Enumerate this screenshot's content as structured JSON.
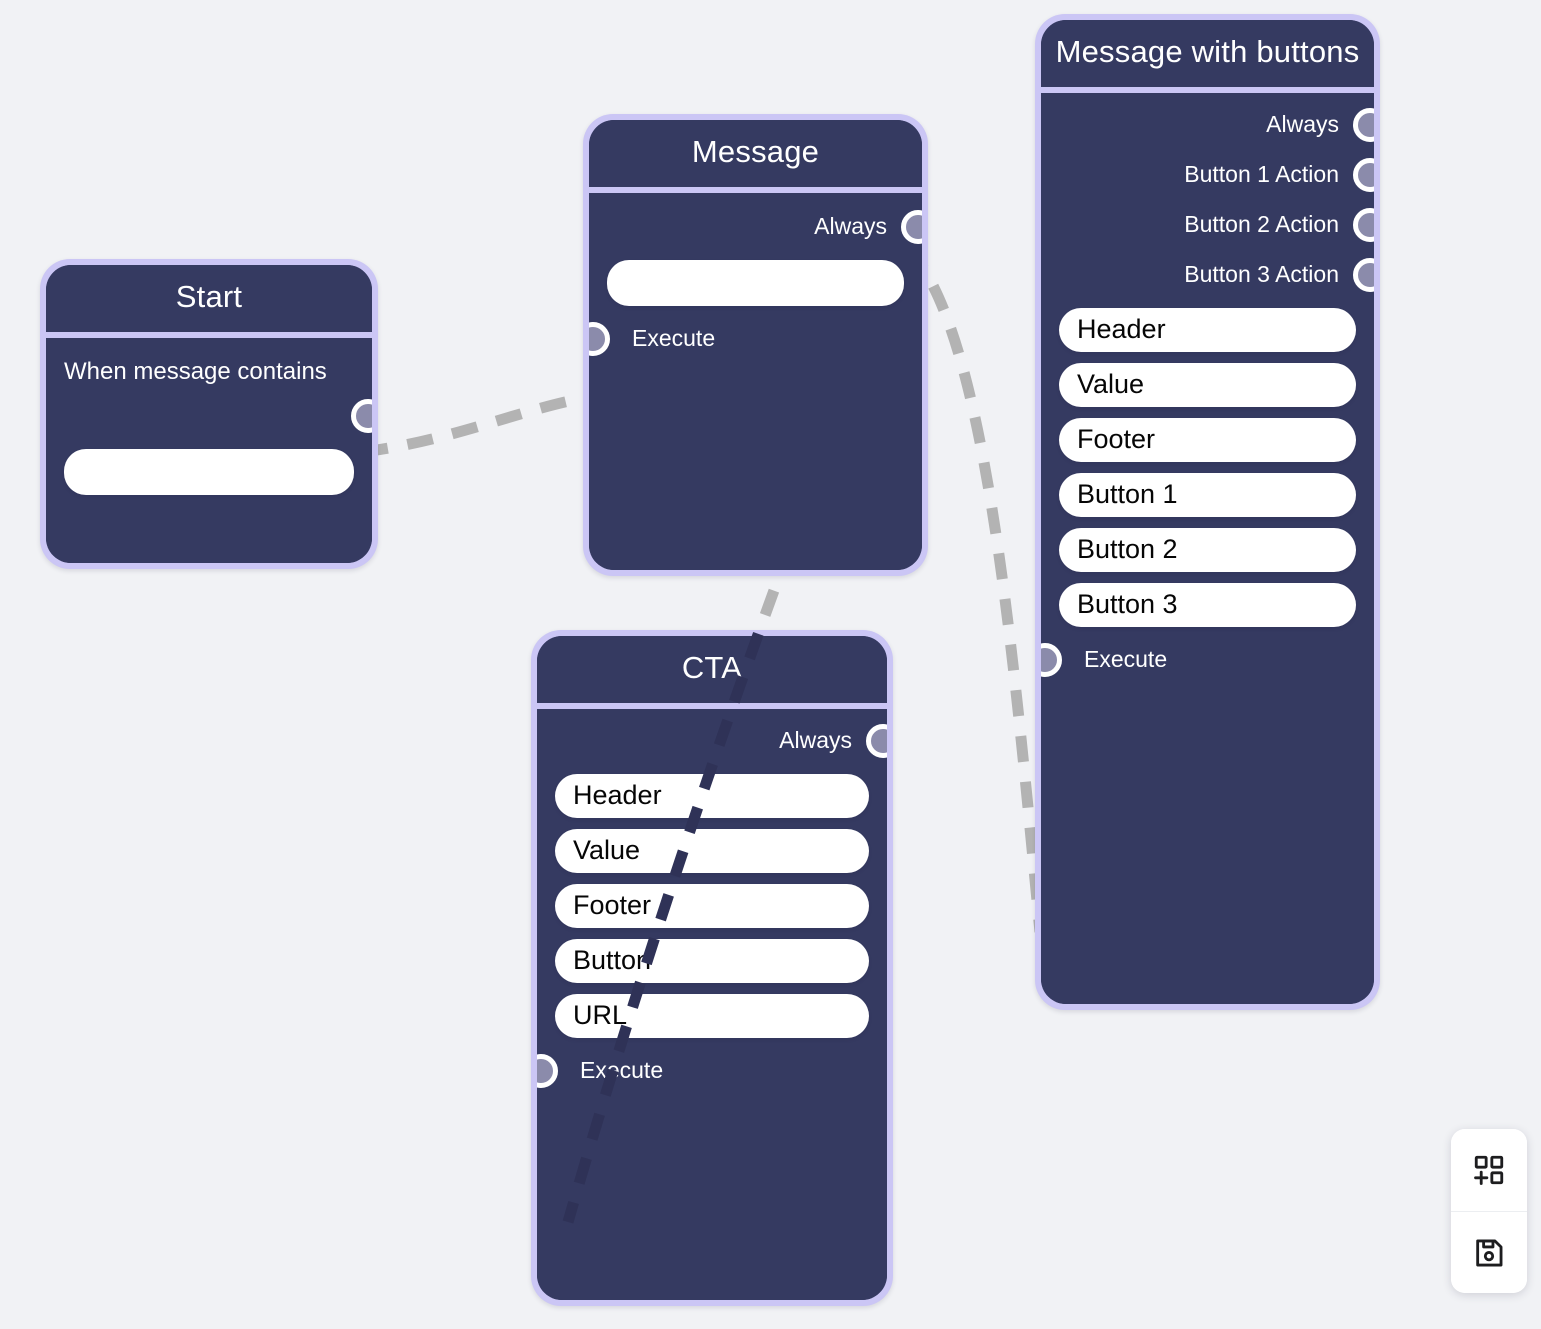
{
  "canvas": {
    "background_color": "#f1f2f5",
    "node_border_color": "#cbc6f5",
    "node_body_color": "#353a61",
    "port_color": "#8b8bab",
    "edge_color": "#b3b3b3"
  },
  "nodes": {
    "start": {
      "title": "Start",
      "condition_label": "When message contains",
      "output_port_label": "",
      "fields": [
        {
          "name": "keyword",
          "value": "",
          "placeholder": ""
        }
      ]
    },
    "message": {
      "title": "Message",
      "outputs": [
        {
          "label": "Always"
        }
      ],
      "inputs": [
        {
          "label": "Execute"
        }
      ],
      "fields": [
        {
          "name": "text",
          "value": "",
          "placeholder": ""
        }
      ]
    },
    "cta": {
      "title": "CTA",
      "outputs": [
        {
          "label": "Always"
        }
      ],
      "inputs": [
        {
          "label": "Execute"
        }
      ],
      "fields": [
        {
          "name": "header",
          "value": "Header",
          "placeholder": "Header"
        },
        {
          "name": "value",
          "value": "Value",
          "placeholder": "Value"
        },
        {
          "name": "footer",
          "value": "Footer",
          "placeholder": "Footer"
        },
        {
          "name": "button",
          "value": "Button",
          "placeholder": "Button"
        },
        {
          "name": "url",
          "value": "URL",
          "placeholder": "URL"
        }
      ]
    },
    "message_with_buttons": {
      "title": "Message with buttons",
      "outputs": [
        {
          "label": "Always"
        },
        {
          "label": "Button 1 Action"
        },
        {
          "label": "Button 2 Action"
        },
        {
          "label": "Button 3 Action"
        }
      ],
      "inputs": [
        {
          "label": "Execute"
        }
      ],
      "fields": [
        {
          "name": "header",
          "value": "Header",
          "placeholder": "Header"
        },
        {
          "name": "value",
          "value": "Value",
          "placeholder": "Value"
        },
        {
          "name": "footer",
          "value": "Footer",
          "placeholder": "Footer"
        },
        {
          "name": "button1",
          "value": "Button 1",
          "placeholder": "Button 1"
        },
        {
          "name": "button2",
          "value": "Button 2",
          "placeholder": "Button 2"
        },
        {
          "name": "button3",
          "value": "Button 3",
          "placeholder": "Button 3"
        }
      ]
    }
  },
  "edges": [
    {
      "from": "start.output",
      "to": "message.execute"
    },
    {
      "from": "message.always",
      "to": "cta.execute"
    },
    {
      "from": "message.always",
      "to": "message_with_buttons.execute"
    }
  ],
  "toolbar": {
    "add_node": {
      "icon": "add-node-grid-icon",
      "label": "Add node"
    },
    "save": {
      "icon": "save-floppy-icon",
      "label": "Save"
    }
  }
}
